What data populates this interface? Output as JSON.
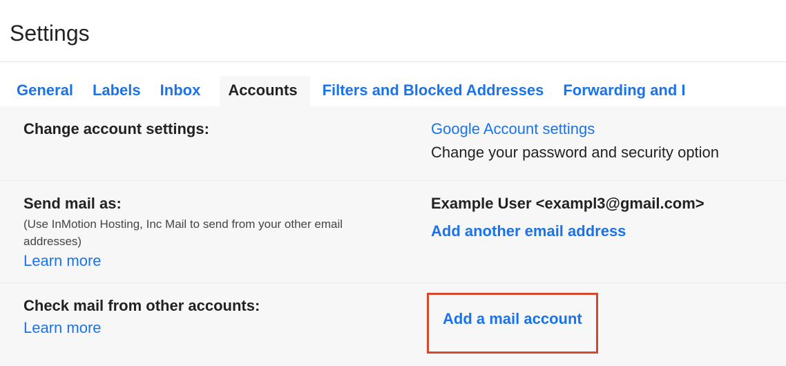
{
  "page": {
    "title": "Settings"
  },
  "tabs": {
    "general": "General",
    "labels": "Labels",
    "inbox": "Inbox",
    "accounts": "Accounts",
    "filters": "Filters and Blocked Addresses",
    "forwarding": "Forwarding and I"
  },
  "sections": {
    "change_account": {
      "heading": "Change account settings:",
      "link": "Google Account settings",
      "desc": "Change your password and security option"
    },
    "send_as": {
      "heading": "Send mail as:",
      "subtext": "(Use InMotion Hosting, Inc Mail to send from your other email addresses)",
      "learn_more": "Learn more",
      "user": "Example User <exampl3@gmail.com>",
      "add_link": "Add another email address"
    },
    "check_mail": {
      "heading": "Check mail from other accounts:",
      "learn_more": "Learn more",
      "add_link": "Add a mail account"
    }
  }
}
